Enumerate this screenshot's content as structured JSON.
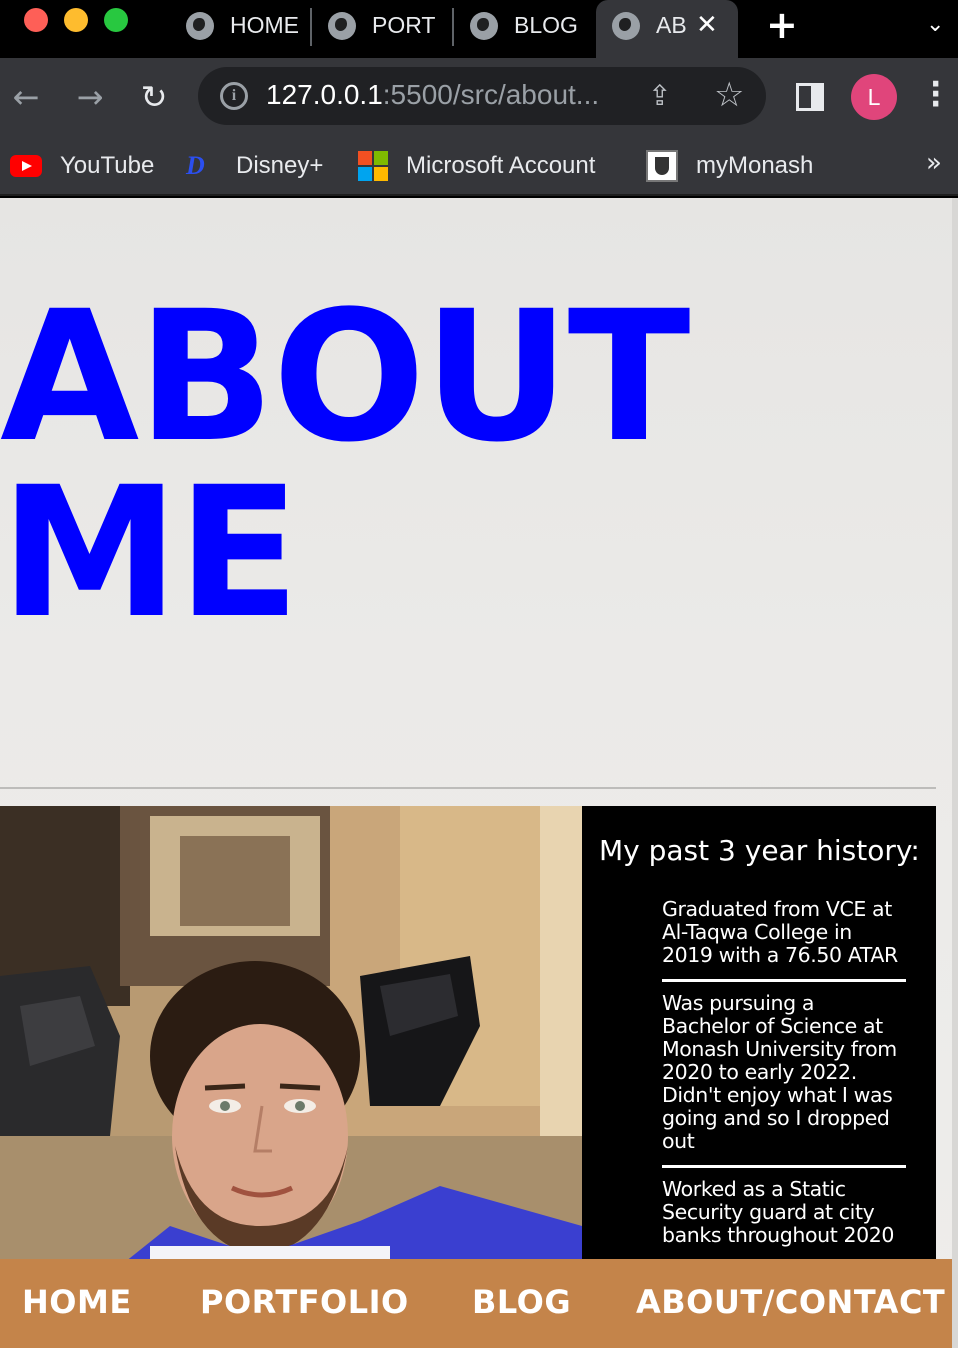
{
  "browser": {
    "tabs": [
      {
        "title": "HOME",
        "active": false
      },
      {
        "title": "PORT",
        "active": false
      },
      {
        "title": "BLOG",
        "active": false
      },
      {
        "title": "AB",
        "active": true
      }
    ],
    "new_tab_label": "+",
    "tab_menu_label": "⌄",
    "url_host": "127.0.0.1",
    "url_rest": ":5500/src/about...",
    "profile_initial": "L",
    "bookmarks": [
      {
        "label": "YouTube",
        "icon": "youtube-icon"
      },
      {
        "label": "Disney+",
        "icon": "disney-icon"
      },
      {
        "label": "Microsoft Account",
        "icon": "microsoft-icon"
      },
      {
        "label": "myMonash",
        "icon": "monash-icon"
      }
    ],
    "bookmarks_more": "»"
  },
  "page": {
    "title_line1": "ABOUT",
    "title_line2": "ME",
    "title_color": "#0000ff",
    "history_heading": "My past 3 year history:",
    "history_items": [
      "Graduated from VCE at Al-Taqwa College in 2019 with a 76.50 ATAR",
      "Was pursuing a Bachelor of Science at Monash University from 2020 to early 2022. Didn't enjoy what I was going and so I dropped out",
      "Worked as a Static Security guard at city banks throughout 2020"
    ],
    "nav": [
      {
        "label": "HOME"
      },
      {
        "label": "PORTFOLIO"
      },
      {
        "label": "BLOG"
      },
      {
        "label": "ABOUT/CONTACT"
      }
    ],
    "nav_color": "#c4844a"
  }
}
